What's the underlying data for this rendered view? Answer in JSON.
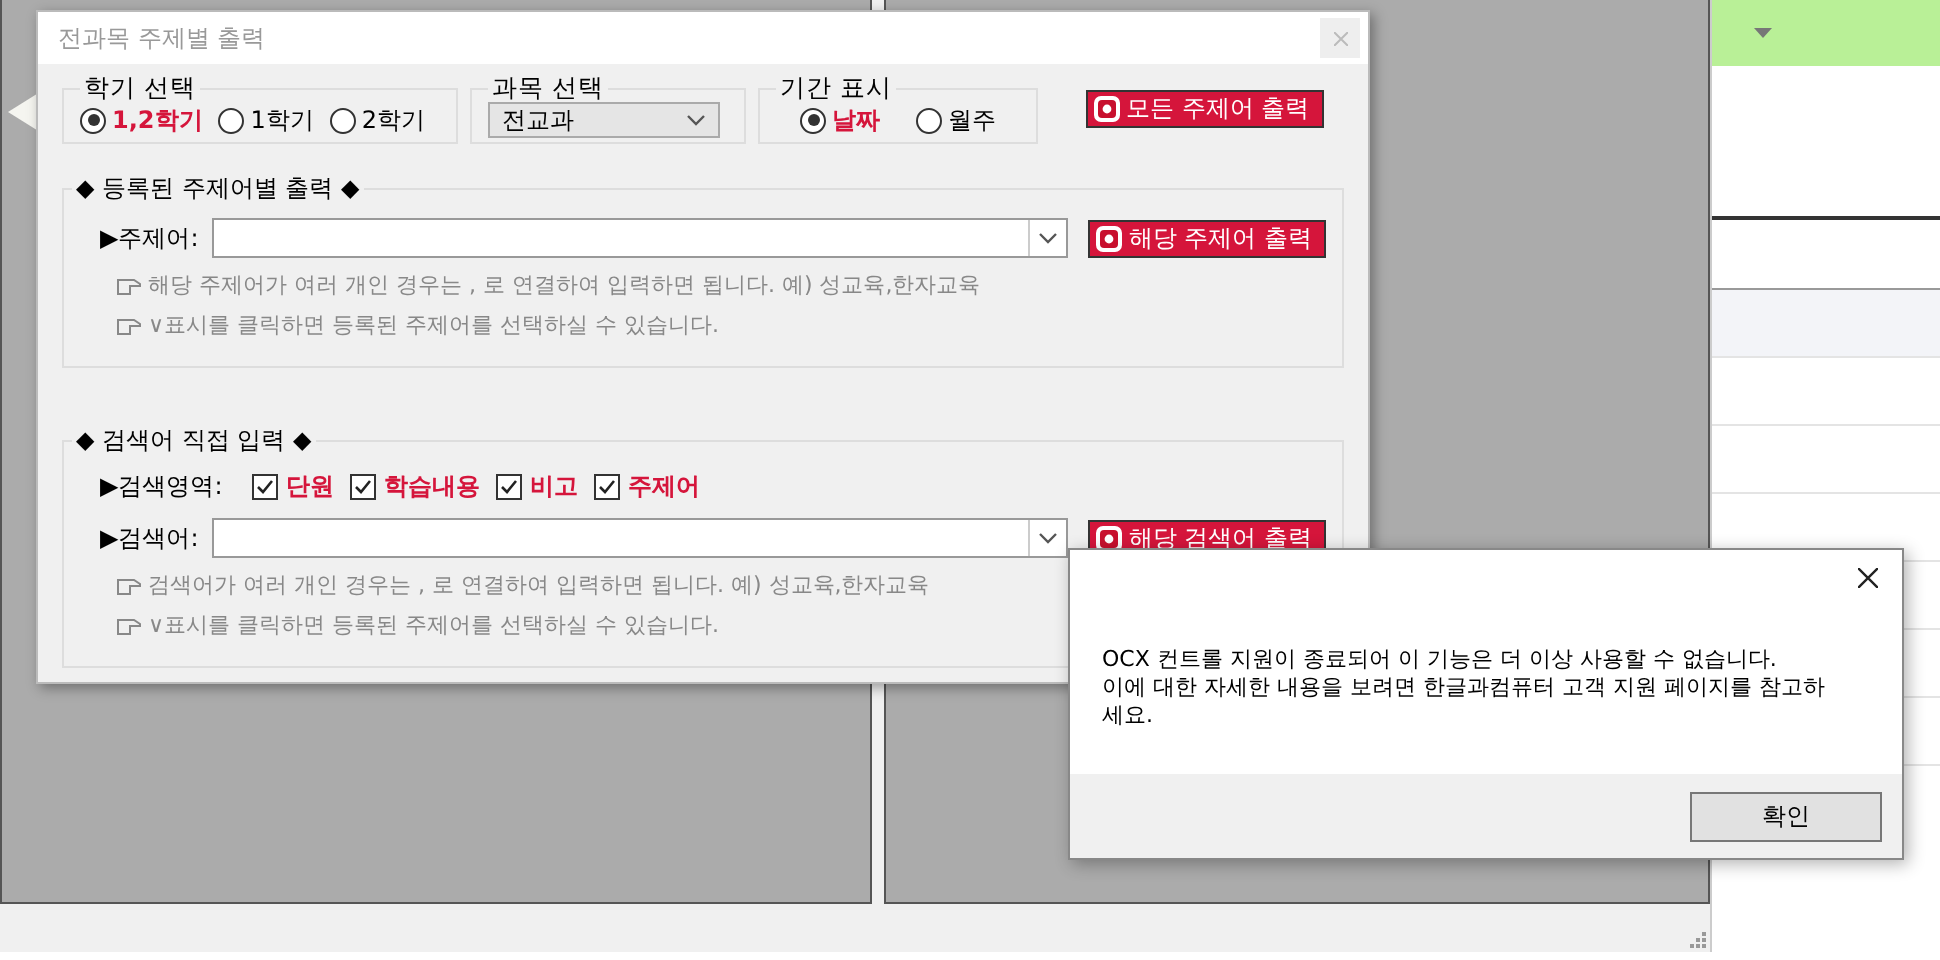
{
  "dialog": {
    "title": "전과목 주제별 출력",
    "semester": {
      "label": "학기 선택",
      "options": [
        {
          "label": "1,2학기",
          "selected": true
        },
        {
          "label": "1학기",
          "selected": false
        },
        {
          "label": "2학기",
          "selected": false
        }
      ]
    },
    "subject": {
      "label": "과목 선택",
      "value": "전교과"
    },
    "period": {
      "label": "기간 표시",
      "options": [
        {
          "label": "날짜",
          "selected": true
        },
        {
          "label": "월주",
          "selected": false
        }
      ]
    },
    "all_button": "모든 주제어 출력",
    "registered": {
      "heading": "◆ 등록된 주제어별 출력 ◆",
      "field_label": "▶주제어:",
      "button": "해당 주제어 출력",
      "notes": [
        "해당 주제어가 여러 개인 경우는 , 로 연결하여 입력하면 됩니다.  예) 성교육,한자교육",
        "∨표시를 클릭하면 등록된 주제어를 선택하실 수 있습니다."
      ]
    },
    "search": {
      "heading": "◆ 검색어 직접 입력 ◆",
      "area_label": "▶검색영역:",
      "areas": [
        {
          "label": "단원",
          "checked": true
        },
        {
          "label": "학습내용",
          "checked": true
        },
        {
          "label": "비고",
          "checked": true
        },
        {
          "label": "주제어",
          "checked": true
        }
      ],
      "field_label": "▶검색어:",
      "button": "해당 검색어 출력",
      "notes": [
        "검색어가 여러 개인 경우는 , 로 연결하여 입력하면 됩니다.  예) 성교육,한자교육",
        "∨표시를 클릭하면 등록된 주제어를 선택하실 수 있습니다."
      ]
    }
  },
  "message_box": {
    "lines": [
      "OCX 컨트롤 지원이 종료되어 이 기능은 더 이상 사용할 수 없습니다.",
      "이에 대한 자세한 내용을 보려면 한글과컴퓨터 고객 지원 페이지를 참고하",
      "세요."
    ],
    "ok_button": "확인"
  }
}
